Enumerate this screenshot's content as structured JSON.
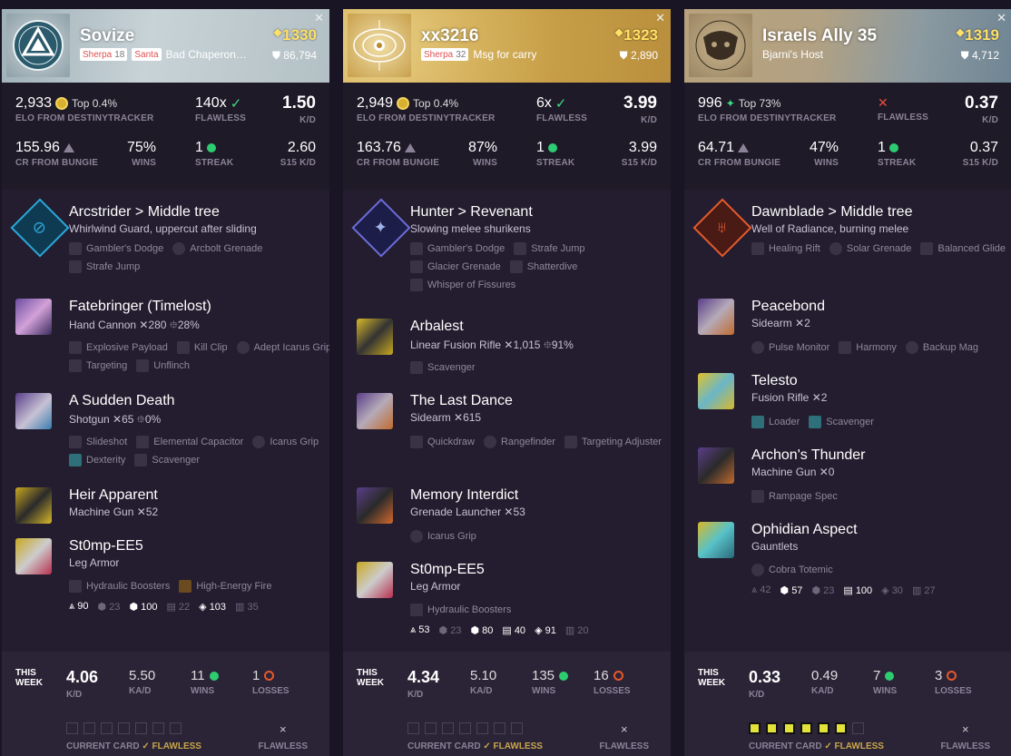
{
  "cards": [
    {
      "name": "Sovize",
      "light": "1330",
      "badge1": "Sherpa",
      "badge1_num": "18",
      "badge2": "Santa",
      "clan": "Bad Chaperon…",
      "triumph": "86,794",
      "elo": "2,933",
      "elo_top": "Top 0.4%",
      "elo_label": "ELO FROM DESTINYTRACKER",
      "flawless": "140x",
      "flawless_label": "FLAWLESS",
      "kd": "1.50",
      "kd_label": "K/D",
      "cr": "155.96",
      "cr_label": "CR FROM BUNGIE",
      "wins": "75%",
      "wins_label": "WINS",
      "streak": "1",
      "streak_label": "STREAK",
      "s15kd": "2.60",
      "s15kd_label": "S15 K/D",
      "subclass": {
        "name": "Arcstrider",
        "arrow": ">",
        "tree": "Middle tree",
        "desc": "Whirlwind Guard, uppercut after sliding",
        "perks": [
          "Gambler's Dodge",
          "Arcbolt Grenade",
          "Strafe Jump"
        ]
      },
      "items": [
        {
          "name": "Fatebringer (Timelost)",
          "type": "Hand Cannon",
          "kills": "280",
          "prec": "28%",
          "perks": [
            "Explosive Payload",
            "Kill Clip",
            "Adept Icarus Grip",
            "Targeting",
            "Unflinch"
          ]
        },
        {
          "name": "A Sudden Death",
          "type": "Shotgun",
          "kills": "65",
          "prec": "0%",
          "perks": [
            "Slideshot",
            "Elemental Capacitor",
            "Icarus Grip",
            "Dexterity",
            "Scavenger"
          ]
        },
        {
          "name": "Heir Apparent",
          "type": "Machine Gun",
          "kills": "52",
          "prec": "",
          "perks": []
        },
        {
          "name": "St0mp-EE5",
          "type": "Leg Armor",
          "kills": "",
          "prec": "",
          "perks": [
            "Hydraulic Boosters",
            "High-Energy Fire"
          ]
        }
      ],
      "armor_stats": [
        "90",
        "23",
        "100",
        "22",
        "103",
        "35"
      ],
      "week": {
        "title1": "THIS",
        "title2": "WEEK",
        "kd": "4.06",
        "kd_label": "K/D",
        "kad": "5.50",
        "kad_label": "KA/D",
        "wins": "11",
        "wins_label": "WINS",
        "losses": "1",
        "losses_label": "LOSSES",
        "current": "CURRENT CARD",
        "flawless": "FLAWLESS",
        "x": "×"
      }
    },
    {
      "name": "xx3216",
      "light": "1323",
      "badge1": "Sherpa",
      "badge1_num": "32",
      "badge2": "",
      "clan": "Msg for carry",
      "triumph": "2,890",
      "elo": "2,949",
      "elo_top": "Top 0.4%",
      "elo_label": "ELO FROM DESTINYTRACKER",
      "flawless": "6x",
      "flawless_label": "FLAWLESS",
      "kd": "3.99",
      "kd_label": "K/D",
      "cr": "163.76",
      "cr_label": "CR FROM BUNGIE",
      "wins": "87%",
      "wins_label": "WINS",
      "streak": "1",
      "streak_label": "STREAK",
      "s15kd": "3.99",
      "s15kd_label": "S15 K/D",
      "subclass": {
        "name": "Hunter",
        "arrow": ">",
        "tree": "Revenant",
        "desc": "Slowing melee shurikens",
        "perks": [
          "Gambler's Dodge",
          "Strafe Jump",
          "Glacier Grenade",
          "Shatterdive",
          "Whisper of Fissures"
        ]
      },
      "items": [
        {
          "name": "Arbalest",
          "type": "Linear Fusion Rifle",
          "kills": "1,015",
          "prec": "91%",
          "perks": [
            "Scavenger"
          ]
        },
        {
          "name": "The Last Dance",
          "type": "Sidearm",
          "kills": "615",
          "prec": "",
          "perks": [
            "Quickdraw",
            "Rangefinder",
            "Targeting Adjuster"
          ]
        },
        {
          "name": "Memory Interdict",
          "type": "Grenade Launcher",
          "kills": "53",
          "prec": "",
          "perks": [
            "Icarus Grip"
          ]
        },
        {
          "name": "St0mp-EE5",
          "type": "Leg Armor",
          "kills": "",
          "prec": "",
          "perks": [
            "Hydraulic Boosters"
          ]
        }
      ],
      "armor_stats": [
        "53",
        "23",
        "80",
        "40",
        "91",
        "20"
      ],
      "week": {
        "title1": "THIS",
        "title2": "WEEK",
        "kd": "4.34",
        "kd_label": "K/D",
        "kad": "5.10",
        "kad_label": "KA/D",
        "wins": "135",
        "wins_label": "WINS",
        "losses": "16",
        "losses_label": "LOSSES",
        "current": "CURRENT CARD",
        "flawless": "FLAWLESS",
        "x": "×"
      }
    },
    {
      "name": "Israels Ally 35",
      "light": "1319",
      "badge1": "",
      "badge1_num": "",
      "badge2": "",
      "clan": "Bjarni's Host",
      "triumph": "4,712",
      "elo": "996",
      "elo_top": "Top 73%",
      "elo_label": "ELO FROM DESTINYTRACKER",
      "flawless": "",
      "flawless_label": "FLAWLESS",
      "kd": "0.37",
      "kd_label": "K/D",
      "cr": "64.71",
      "cr_label": "CR FROM BUNGIE",
      "wins": "47%",
      "wins_label": "WINS",
      "streak": "1",
      "streak_label": "STREAK",
      "s15kd": "0.37",
      "s15kd_label": "S15 K/D",
      "subclass": {
        "name": "Dawnblade",
        "arrow": ">",
        "tree": "Middle tree",
        "desc": "Well of Radiance, burning melee",
        "perks": [
          "Healing Rift",
          "Solar Grenade",
          "Balanced Glide"
        ]
      },
      "items": [
        {
          "name": "Peacebond",
          "type": "Sidearm",
          "kills": "2",
          "prec": "",
          "perks": [
            "Pulse Monitor",
            "Harmony",
            "Backup Mag"
          ]
        },
        {
          "name": "Telesto",
          "type": "Fusion Rifle",
          "kills": "2",
          "prec": "",
          "perks": [
            "Loader",
            "Scavenger"
          ]
        },
        {
          "name": "Archon's Thunder",
          "type": "Machine Gun",
          "kills": "0",
          "prec": "",
          "perks": [
            "Rampage Spec"
          ]
        },
        {
          "name": "Ophidian Aspect",
          "type": "Gauntlets",
          "kills": "",
          "prec": "",
          "perks": [
            "Cobra Totemic"
          ]
        }
      ],
      "armor_stats": [
        "42",
        "57",
        "23",
        "100",
        "30",
        "27"
      ],
      "week": {
        "title1": "THIS",
        "title2": "WEEK",
        "kd": "0.33",
        "kd_label": "K/D",
        "kad": "0.49",
        "kad_label": "KA/D",
        "wins": "7",
        "wins_label": "WINS",
        "losses": "3",
        "losses_label": "LOSSES",
        "current": "CURRENT CARD",
        "flawless": "FLAWLESS",
        "x": "×"
      }
    }
  ],
  "colors": {
    "arc": "#2aa7d8",
    "void": "#6b6ed6",
    "solar": "#e25b2e",
    "win": "#2ecc71",
    "loss": "#e8572a",
    "light": "#ffe066"
  },
  "icons": [
    "close-icon",
    "light-diamond-icon",
    "triumph-icon",
    "elo-icon",
    "check-icon",
    "triangle-icon",
    "win-dot-icon",
    "loss-ring-icon"
  ]
}
